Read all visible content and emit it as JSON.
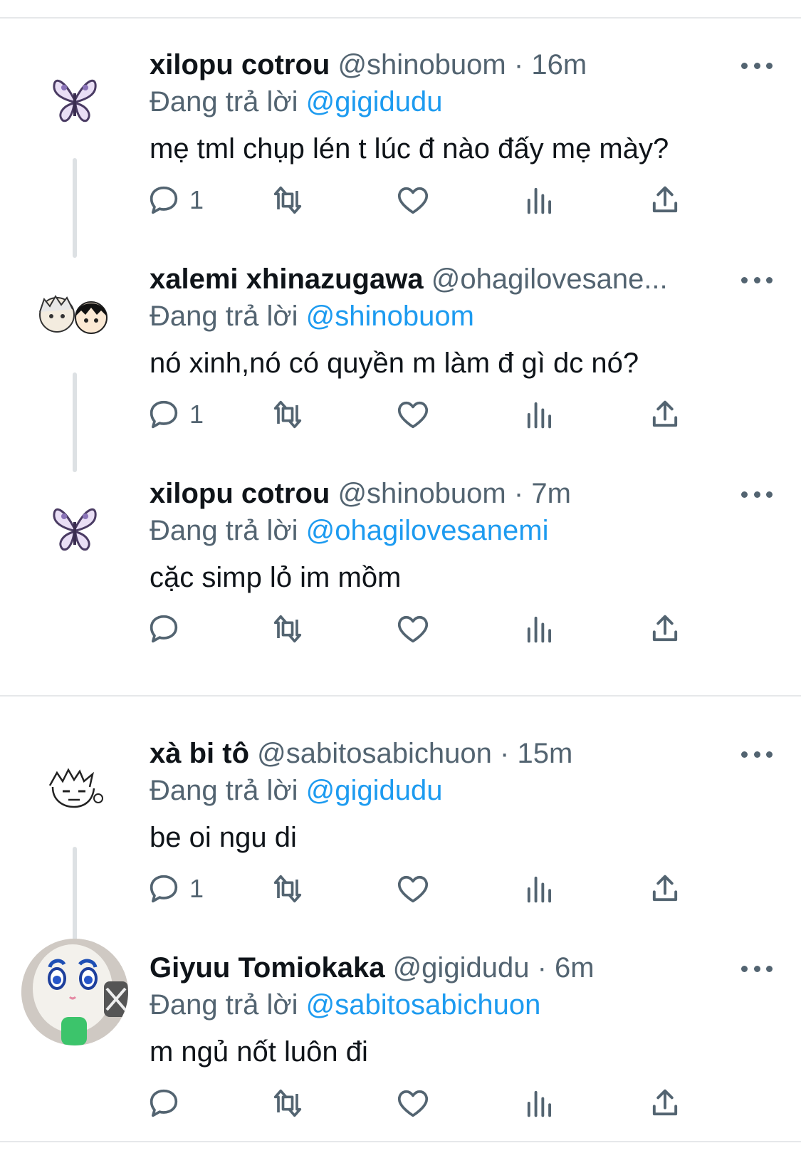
{
  "tweets": [
    {
      "name": "xilopu cotrou",
      "handle": "@shinobuom",
      "sep": "·",
      "time": "16m",
      "reply_prefix": "Đang trả lời",
      "reply_to": "@gigidudu",
      "text": "mẹ tml chụp lén t lúc đ nào đấy mẹ mày?",
      "reply_count": "1",
      "avatar_icon": "butterfly-icon"
    },
    {
      "name": "xalemi xhinazugawa",
      "handle": "@ohagilovesane...",
      "sep": "",
      "time": "",
      "reply_prefix": "Đang trả lời",
      "reply_to": "@shinobuom",
      "text": "nó xinh,nó có quyền m làm đ gì dc nó?",
      "reply_count": "1",
      "avatar_icon": "anime-duo-icon"
    },
    {
      "name": "xilopu cotrou",
      "handle": "@shinobuom",
      "sep": "·",
      "time": "7m",
      "reply_prefix": "Đang trả lời",
      "reply_to": "@ohagilovesanemi",
      "text": "cặc simp lỏ im mồm",
      "reply_count": "",
      "avatar_icon": "butterfly-icon"
    },
    {
      "name": "xà bi tô",
      "handle": "@sabitosabichuon",
      "sep": "·",
      "time": "15m",
      "reply_prefix": "Đang trả lời",
      "reply_to": "@gigidudu",
      "text": "be oi ngu di",
      "reply_count": "1",
      "avatar_icon": "sketch-face-icon"
    },
    {
      "name": "Giyuu Tomiokaka",
      "handle": "@gigidudu",
      "sep": "·",
      "time": "6m",
      "reply_prefix": "Đang trả lời",
      "reply_to": "@sabitosabichuon",
      "text": "m ngủ nốt luôn đi",
      "reply_count": "",
      "avatar_icon": "plush-doll-icon"
    }
  ],
  "colors": {
    "link": "#1d9bf0",
    "muted": "#536471",
    "text": "#0f1419",
    "thread_line": "#dde1e4"
  }
}
